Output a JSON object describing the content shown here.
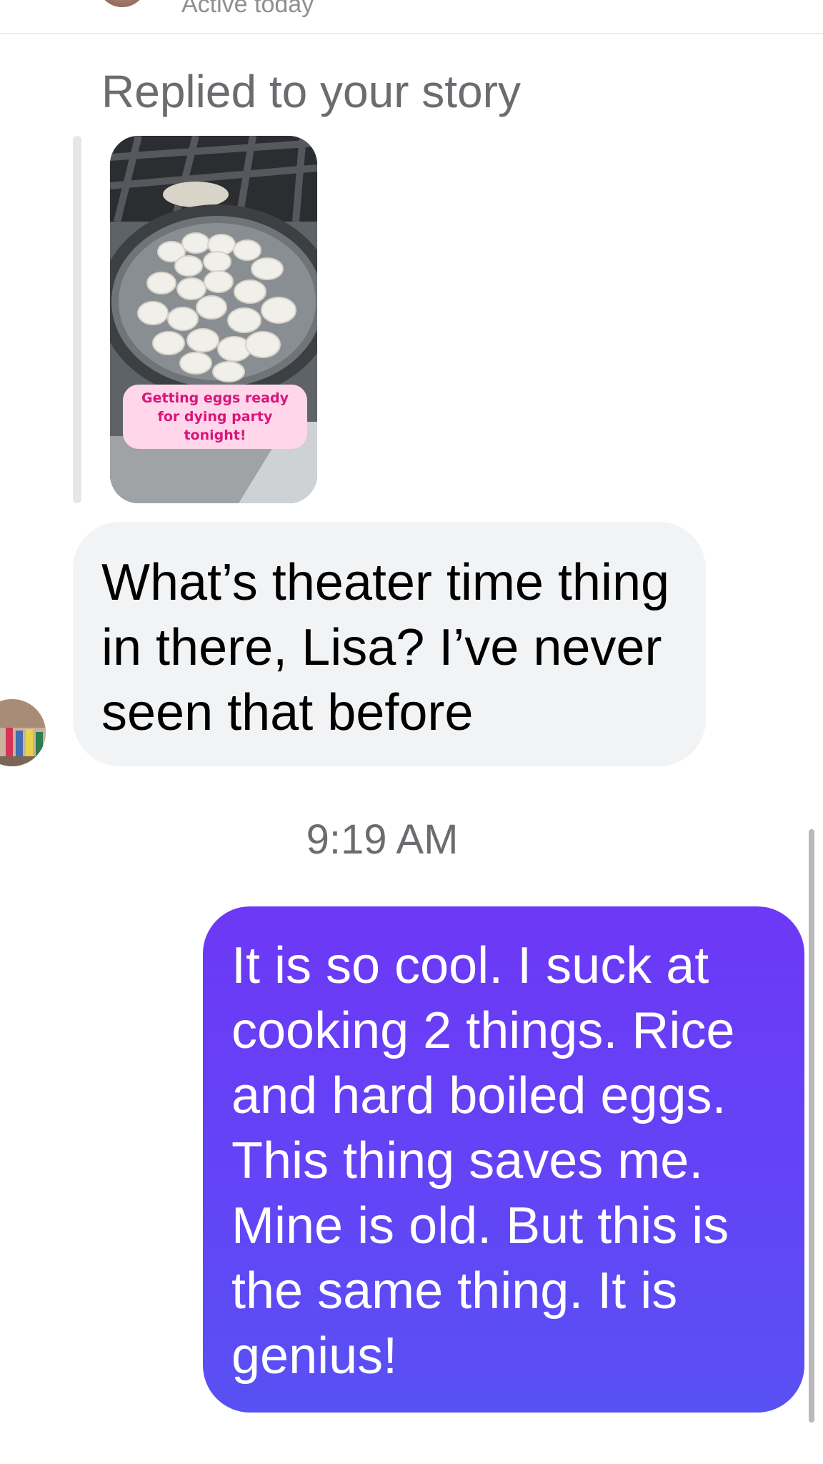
{
  "header": {
    "status": "Active today"
  },
  "story_reply": {
    "label": "Replied to your story",
    "sticker_text": "Getting eggs ready for dying party tonight!"
  },
  "messages": {
    "incoming": {
      "text": "What’s theater time thing in there, Lisa? I’ve never seen that before"
    },
    "timestamp": "9:19 AM",
    "outgoing": {
      "text": "It is so cool. I suck at cooking 2 things. Rice and hard boiled eggs. This thing saves me. Mine is old. But this is the same thing. It is genius!",
      "gradient_top": "#6d38f6",
      "gradient_bottom": "#5851f4"
    }
  },
  "colors": {
    "incoming_bubble": "#f2f3f5",
    "secondary_text": "#6b6b70",
    "sticker_background": "#ffd6ea",
    "sticker_text": "#d8167a"
  }
}
